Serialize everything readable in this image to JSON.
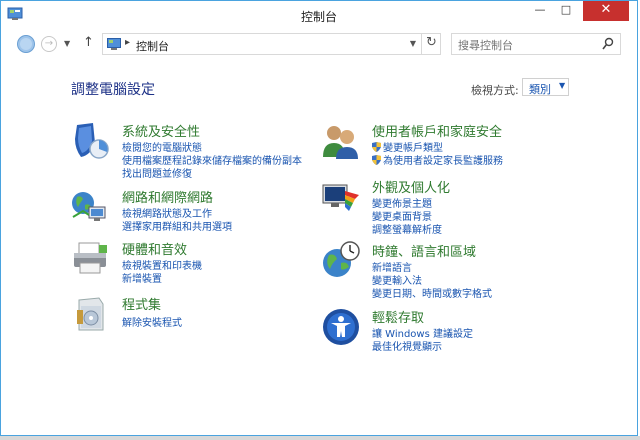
{
  "window": {
    "title": "控制台",
    "buttons": {
      "minimize": "—",
      "maximize": "□",
      "close": "✕"
    }
  },
  "nav": {
    "address_sep": "▸",
    "address_path": "控制台",
    "search_placeholder": "搜尋控制台",
    "up_glyph": "↑",
    "back_glyph": "",
    "forward_glyph": "→",
    "recent_glyph": "▼",
    "address_dropdown_glyph": "▼",
    "refresh_glyph": "↻"
  },
  "content": {
    "heading": "調整電腦設定",
    "view_by_label": "檢視方式:",
    "view_by_value": "類別",
    "view_by_caret": "▼"
  },
  "categories": {
    "system_security": {
      "title": "系統及安全性",
      "links": [
        "檢閱您的電腦狀態",
        "使用檔案歷程記錄來儲存檔案的備份副本",
        "找出問題並修復"
      ]
    },
    "network": {
      "title": "網路和網際網路",
      "links": [
        "檢視網路狀態及工作",
        "選擇家用群組和共用選項"
      ]
    },
    "hardware": {
      "title": "硬體和音效",
      "links": [
        "檢視裝置和印表機",
        "新增裝置"
      ]
    },
    "programs": {
      "title": "程式集",
      "links": [
        "解除安裝程式"
      ]
    },
    "user_accounts": {
      "title": "使用者帳戶和家庭安全",
      "links": [
        "變更帳戶類型",
        "為使用者設定家長監護服務"
      ]
    },
    "appearance": {
      "title": "外觀及個人化",
      "links": [
        "變更佈景主題",
        "變更桌面背景",
        "調整螢幕解析度"
      ]
    },
    "clock": {
      "title": "時鐘、語言和區域",
      "links": [
        "新增語言",
        "變更輸入法",
        "變更日期、時間或數字格式"
      ]
    },
    "ease_of_access": {
      "title": "輕鬆存取",
      "links": [
        "讓 Windows 建議設定",
        "最佳化視覺顯示"
      ]
    }
  },
  "icons": {
    "app": "control-panel-icon",
    "system_security": "shield-chart-icon",
    "network": "network-globe-icon",
    "hardware": "printer-icon",
    "programs": "software-box-icon",
    "user_accounts": "users-icon",
    "appearance": "monitor-palette-icon",
    "clock": "globe-clock-icon",
    "ease_of_access": "accessibility-icon",
    "search": "search-icon",
    "uac": "uac-shield-icon"
  },
  "colors": {
    "title_accent": "#2f7a2f",
    "link": "#1a55b0",
    "heading": "#1e3287",
    "close_button": "#c7302e",
    "window_border": "#4aa3df"
  }
}
